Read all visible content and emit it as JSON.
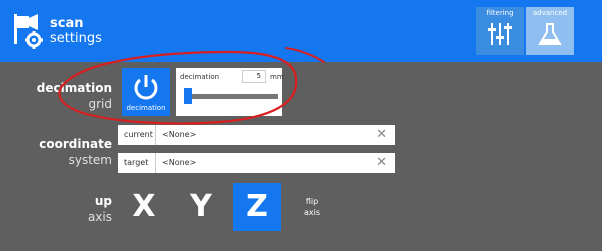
{
  "header": {
    "title_line1": "scan",
    "title_line2": "settings",
    "filtering_label": "filtering",
    "advanced_label": "advanced",
    "background_color": "#1477f0"
  },
  "decimation": {
    "label_bold": "decimation",
    "label_light": "grid",
    "button_label": "decimation",
    "panel_label": "decimation",
    "value": "5",
    "unit": "mm",
    "slider_value": 0.0
  },
  "coordinate": {
    "label_bold": "coordinate",
    "label_light": "system",
    "current_label": "current",
    "current_value": "<None>",
    "target_label": "target",
    "target_value": "<None>"
  },
  "up_axis": {
    "label_bold": "up",
    "label_light": "axis",
    "x_label": "X",
    "y_label": "Y",
    "z_label": "Z",
    "selected": "Z",
    "flip_line1": "flip",
    "flip_line2": "axis"
  },
  "icons": {
    "header": "scanner-gear-icon",
    "filtering": "sliders-icon",
    "advanced": "flask-icon",
    "decimation": "power-icon",
    "clear": "close-icon"
  }
}
